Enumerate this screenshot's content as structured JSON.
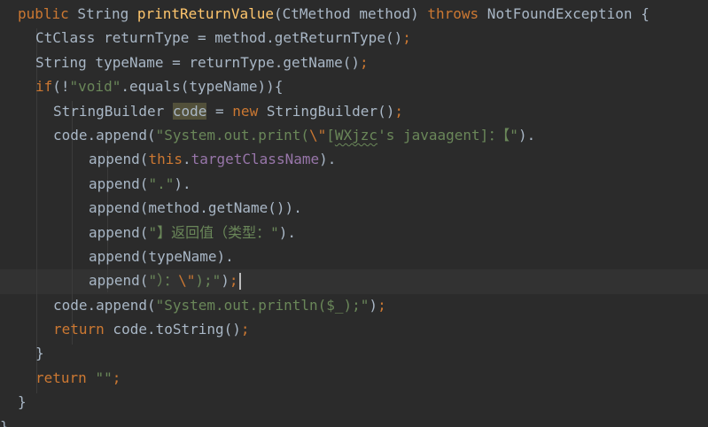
{
  "editor": {
    "lines": [
      {
        "indent": 2,
        "tokens": [
          {
            "t": "public",
            "c": "keyword"
          },
          {
            "t": " String ",
            "c": "plain"
          },
          {
            "t": "printReturnValue",
            "c": "method"
          },
          {
            "t": "(CtMethod method) ",
            "c": "plain"
          },
          {
            "t": "throws",
            "c": "keyword"
          },
          {
            "t": " NotFoundException {",
            "c": "plain"
          }
        ]
      },
      {
        "indent": 4,
        "tokens": [
          {
            "t": "CtClass returnType = method.getReturnType()",
            "c": "plain"
          },
          {
            "t": ";",
            "c": "keyword"
          }
        ]
      },
      {
        "indent": 4,
        "tokens": [
          {
            "t": "String typeName = returnType.getName()",
            "c": "plain"
          },
          {
            "t": ";",
            "c": "keyword"
          }
        ]
      },
      {
        "indent": 4,
        "tokens": [
          {
            "t": "if",
            "c": "keyword"
          },
          {
            "t": "(!",
            "c": "plain"
          },
          {
            "t": "\"void\"",
            "c": "string"
          },
          {
            "t": ".equals(typeName)){",
            "c": "plain"
          }
        ]
      },
      {
        "indent": 6,
        "tokens": [
          {
            "t": "StringBuilder ",
            "c": "plain"
          },
          {
            "t": "code",
            "c": "plain",
            "highlight": true
          },
          {
            "t": " = ",
            "c": "plain"
          },
          {
            "t": "new",
            "c": "keyword"
          },
          {
            "t": " StringBuilder()",
            "c": "plain"
          },
          {
            "t": ";",
            "c": "keyword"
          }
        ]
      },
      {
        "indent": 6,
        "tokens": [
          {
            "t": "code.append(",
            "c": "plain"
          },
          {
            "t": "\"System.out.print(",
            "c": "string"
          },
          {
            "t": "\\\"",
            "c": "keyword"
          },
          {
            "t": "[",
            "c": "string"
          },
          {
            "t": "WXjzc",
            "c": "string",
            "typo": true
          },
          {
            "t": "'s javaagent]：【\"",
            "c": "string"
          },
          {
            "t": ").",
            "c": "plain"
          }
        ]
      },
      {
        "indent": 10,
        "tokens": [
          {
            "t": "append(",
            "c": "plain"
          },
          {
            "t": "this",
            "c": "keyword"
          },
          {
            "t": ".",
            "c": "plain"
          },
          {
            "t": "targetClassName",
            "c": "field"
          },
          {
            "t": ").",
            "c": "plain"
          }
        ]
      },
      {
        "indent": 10,
        "tokens": [
          {
            "t": "append(",
            "c": "plain"
          },
          {
            "t": "\".\"",
            "c": "string"
          },
          {
            "t": ").",
            "c": "plain"
          }
        ]
      },
      {
        "indent": 10,
        "tokens": [
          {
            "t": "append(method.getName()).",
            "c": "plain"
          }
        ]
      },
      {
        "indent": 10,
        "tokens": [
          {
            "t": "append(",
            "c": "plain"
          },
          {
            "t": "\"】返回值（类型：\"",
            "c": "string"
          },
          {
            "t": ").",
            "c": "plain"
          }
        ]
      },
      {
        "indent": 10,
        "tokens": [
          {
            "t": "append(typeName).",
            "c": "plain"
          }
        ]
      },
      {
        "indent": 10,
        "caret": true,
        "tokens": [
          {
            "t": "append(",
            "c": "plain"
          },
          {
            "t": "\"）：",
            "c": "string"
          },
          {
            "t": "\\\"",
            "c": "keyword"
          },
          {
            "t": ");\"",
            "c": "string"
          },
          {
            "t": ")",
            "c": "plain"
          },
          {
            "t": ";",
            "c": "keyword"
          }
        ]
      },
      {
        "indent": 6,
        "tokens": [
          {
            "t": "code.append(",
            "c": "plain"
          },
          {
            "t": "\"System.out.println($_);\"",
            "c": "string"
          },
          {
            "t": ")",
            "c": "plain"
          },
          {
            "t": ";",
            "c": "keyword"
          }
        ]
      },
      {
        "indent": 6,
        "tokens": [
          {
            "t": "return",
            "c": "keyword"
          },
          {
            "t": " code.toString()",
            "c": "plain"
          },
          {
            "t": ";",
            "c": "keyword"
          }
        ]
      },
      {
        "indent": 4,
        "tokens": [
          {
            "t": "}",
            "c": "plain"
          }
        ]
      },
      {
        "indent": 4,
        "tokens": [
          {
            "t": "return",
            "c": "keyword"
          },
          {
            "t": " ",
            "c": "plain"
          },
          {
            "t": "\"\"",
            "c": "string"
          },
          {
            "t": ";",
            "c": "keyword"
          }
        ]
      },
      {
        "indent": 2,
        "tokens": [
          {
            "t": "}",
            "c": "plain"
          }
        ]
      },
      {
        "indent": 0,
        "tokens": [
          {
            "t": "}",
            "c": "plain"
          }
        ]
      }
    ],
    "colors": {
      "background": "#2b2b2b",
      "current_line": "#323232",
      "keyword": "#cc7832",
      "plain": "#a9b7c6",
      "method": "#ffc66d",
      "string": "#6a8759",
      "field": "#9876aa",
      "usage_highlight": "#52503a"
    }
  }
}
